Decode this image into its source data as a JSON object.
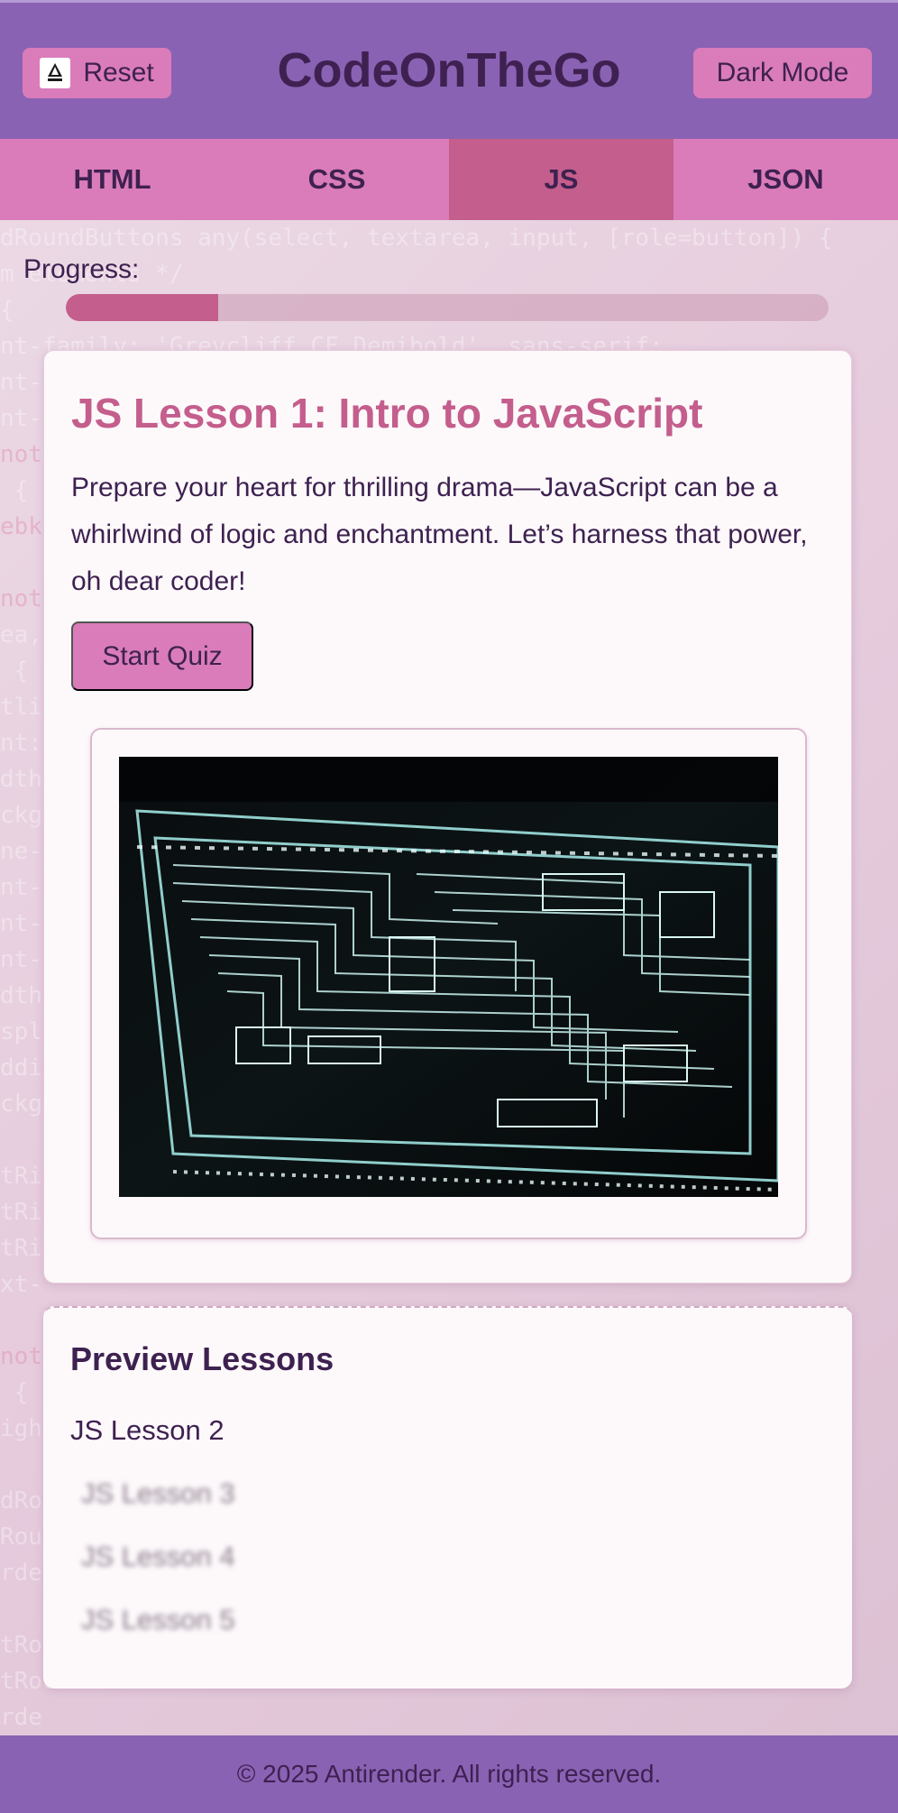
{
  "header": {
    "reset_label": "Reset",
    "title": "CodeOnTheGo",
    "dark_mode_label": "Dark Mode"
  },
  "tabs": [
    {
      "label": "HTML",
      "active": false
    },
    {
      "label": "CSS",
      "active": false
    },
    {
      "label": "JS",
      "active": true
    },
    {
      "label": "JSON",
      "active": false
    }
  ],
  "progress": {
    "label": "Progress:",
    "fraction": 0.2
  },
  "lesson": {
    "title": "JS Lesson 1: Intro to JavaScript",
    "text": "Prepare your heart for thrilling drama—JavaScript can be a whirlwind of logic and enchantment. Let’s harness that power, oh dear coder!",
    "start_quiz_label": "Start Quiz"
  },
  "preview": {
    "title": "Preview Lessons",
    "items": [
      {
        "label": "JS Lesson 2",
        "locked": false
      },
      {
        "label": "JS Lesson 3",
        "locked": true
      },
      {
        "label": "JS Lesson 4",
        "locked": true
      },
      {
        "label": "JS Lesson 5",
        "locked": true
      }
    ]
  },
  "footer": {
    "text": "© 2025 Antirender. All rights reserved."
  },
  "colors": {
    "header_bg": "#8a62b4",
    "accent_pink": "#da7cba",
    "active_tab": "#c45e8c",
    "text_dark": "#3e2150"
  }
}
